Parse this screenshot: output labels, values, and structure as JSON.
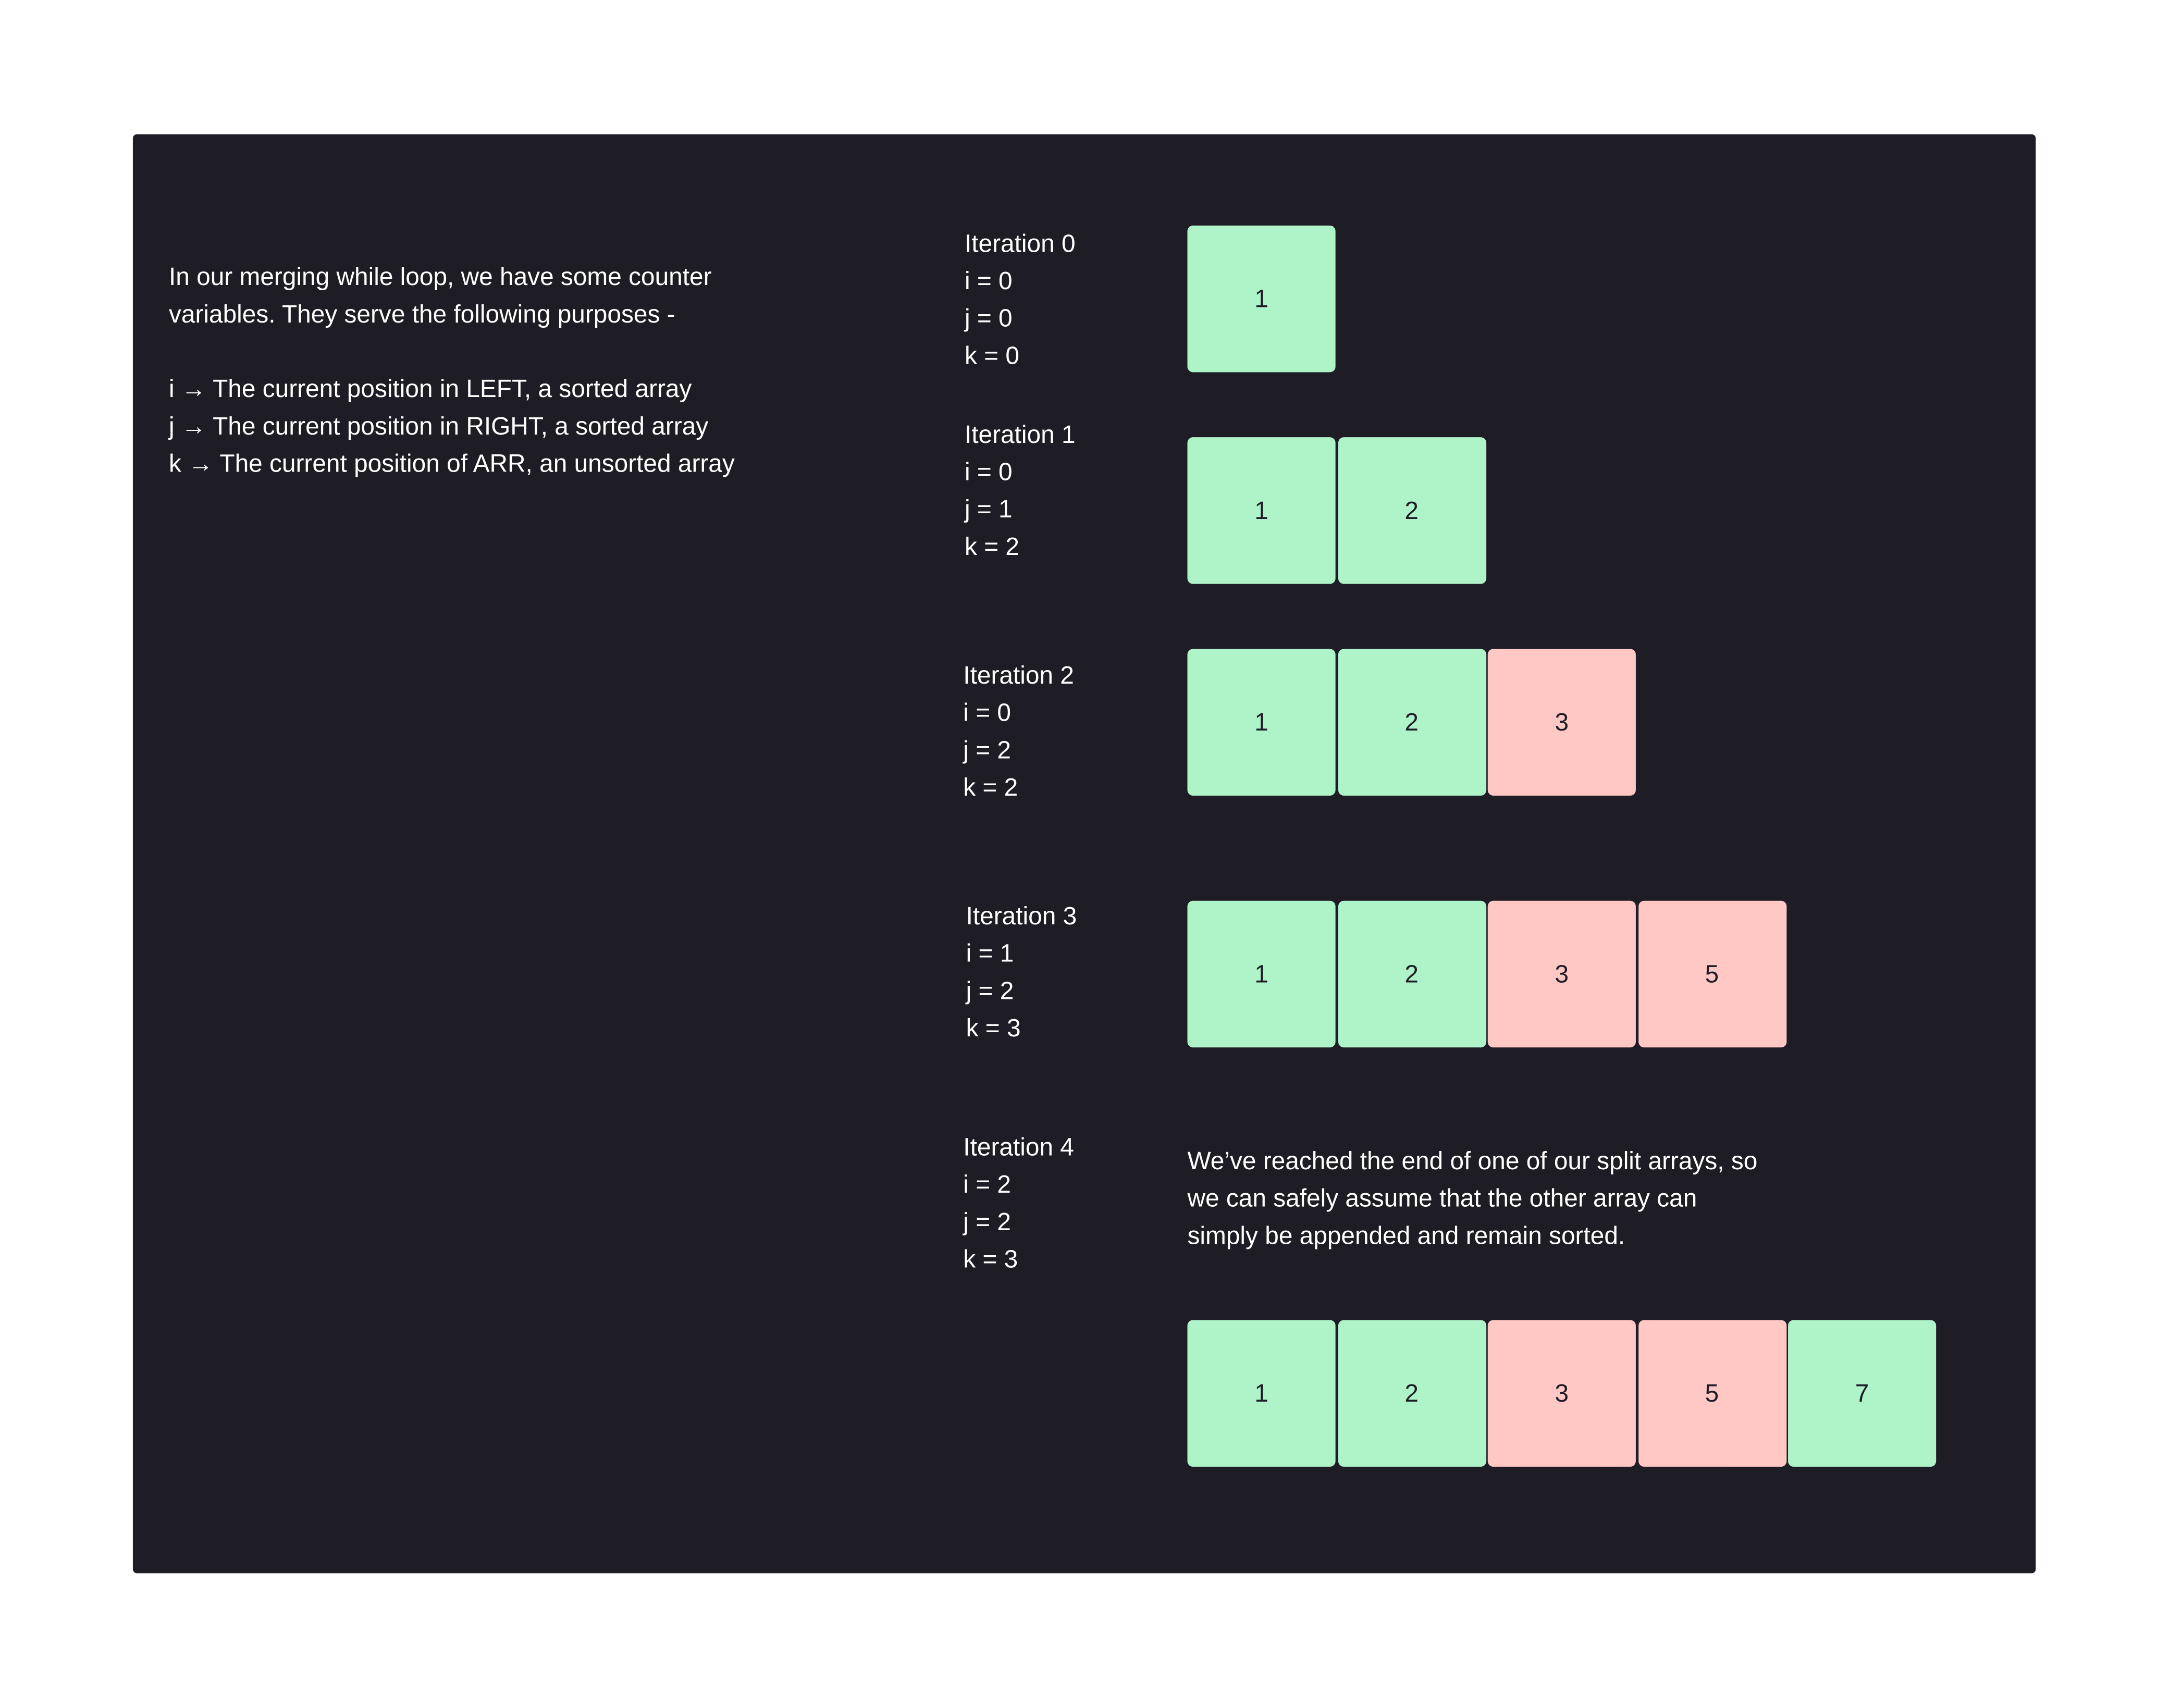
{
  "intro": {
    "line1": "In our merging while loop, we have some counter",
    "line2": "variables. They serve the following purposes -",
    "defs": [
      "i → The current position in LEFT, a sorted array",
      "j → The current position in RIGHT, a sorted array",
      "k → The current position of ARR, an unsorted array"
    ]
  },
  "colors": {
    "background": "#1e1d25",
    "left_cell": "#aff4c9",
    "right_cell": "#ffc8c4"
  },
  "iterations": [
    {
      "title": "Iteration 0",
      "i": "i = 0",
      "j": "j = 0",
      "k": "k = 0",
      "cells": [
        {
          "value": "1",
          "side": "left"
        }
      ]
    },
    {
      "title": "Iteration 1",
      "i": "i = 0",
      "j": "j = 1",
      "k": "k = 2",
      "cells": [
        {
          "value": "1",
          "side": "left"
        },
        {
          "value": "2",
          "side": "left"
        }
      ]
    },
    {
      "title": "Iteration 2",
      "i": "i = 0",
      "j": "j = 2",
      "k": "k = 2",
      "cells": [
        {
          "value": "1",
          "side": "left"
        },
        {
          "value": "2",
          "side": "left"
        },
        {
          "value": "3",
          "side": "right"
        }
      ]
    },
    {
      "title": "Iteration 3",
      "i": "i = 1",
      "j": "j = 2",
      "k": "k = 3",
      "cells": [
        {
          "value": "1",
          "side": "left"
        },
        {
          "value": "2",
          "side": "left"
        },
        {
          "value": "3",
          "side": "right"
        },
        {
          "value": "5",
          "side": "right"
        }
      ]
    },
    {
      "title": "Iteration 4",
      "i": "i = 2",
      "j": "j = 2",
      "k": "k = 3",
      "cells": [
        {
          "value": "1",
          "side": "left"
        },
        {
          "value": "2",
          "side": "left"
        },
        {
          "value": "3",
          "side": "right"
        },
        {
          "value": "5",
          "side": "right"
        },
        {
          "value": "7",
          "side": "left"
        }
      ]
    }
  ],
  "note": {
    "line1": "We’ve reached the end of one of our split arrays, so",
    "line2": "we can safely assume that the other array can",
    "line3": "simply be appended and remain sorted."
  }
}
